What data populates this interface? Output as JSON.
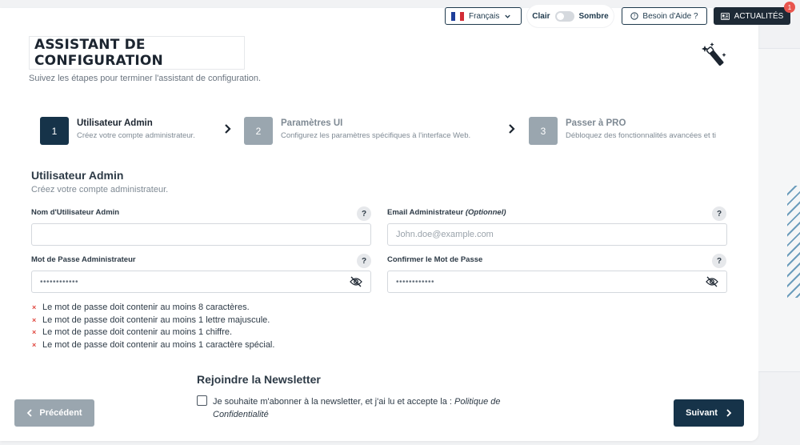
{
  "topbar": {
    "language": "Français",
    "theme_light": "Clair",
    "theme_dark": "Sombre",
    "help_label": "Besoin d'Aide ?",
    "news_label": "ACTUALITÉS",
    "notification_count": "1"
  },
  "header": {
    "title": "ASSISTANT DE CONFIGURATION",
    "subtitle": "Suivez les étapes pour terminer l'assistant de configuration."
  },
  "steps": [
    {
      "number": "1",
      "title": "Utilisateur Admin",
      "description": "Créez votre compte administrateur."
    },
    {
      "number": "2",
      "title": "Paramètres UI",
      "description": "Configurez les paramètres spécifiques à l'interface Web."
    },
    {
      "number": "3",
      "title": "Passer à PRO",
      "description": "Débloquez des fonctionnalités avancées et ti"
    }
  ],
  "form": {
    "section_title": "Utilisateur Admin",
    "section_subtitle": "Créez votre compte administrateur.",
    "username_label": "Nom d'Utilisateur Admin",
    "username_value": "",
    "email_label": "Email Administrateur",
    "email_optional": "(Optionnel)",
    "email_placeholder": "John.doe@example.com",
    "password_label": "Mot de Passe Administrateur",
    "password_placeholder": "••••••••••••",
    "confirm_label": "Confirmer le Mot de Passe",
    "confirm_placeholder": "••••••••••••",
    "help_mark": "?"
  },
  "rules": [
    "Le mot de passe doit contenir au moins 8 caractères.",
    "Le mot de passe doit contenir au moins 1 lettre majuscule.",
    "Le mot de passe doit contenir au moins 1 chiffre.",
    "Le mot de passe doit contenir au moins 1 caractère spécial."
  ],
  "rule_mark": "×",
  "newsletter": {
    "title": "Rejoindre la Newsletter",
    "consent_text": "Je souhaite m'abonner à la newsletter, et j'ai lu et accepte la : ",
    "policy_link": "Politique de Confidentialité"
  },
  "nav": {
    "previous": "Précédent",
    "next": "Suivant"
  },
  "colors": {
    "primary": "#163349",
    "muted": "#9aa6af",
    "error": "#e0473f"
  }
}
